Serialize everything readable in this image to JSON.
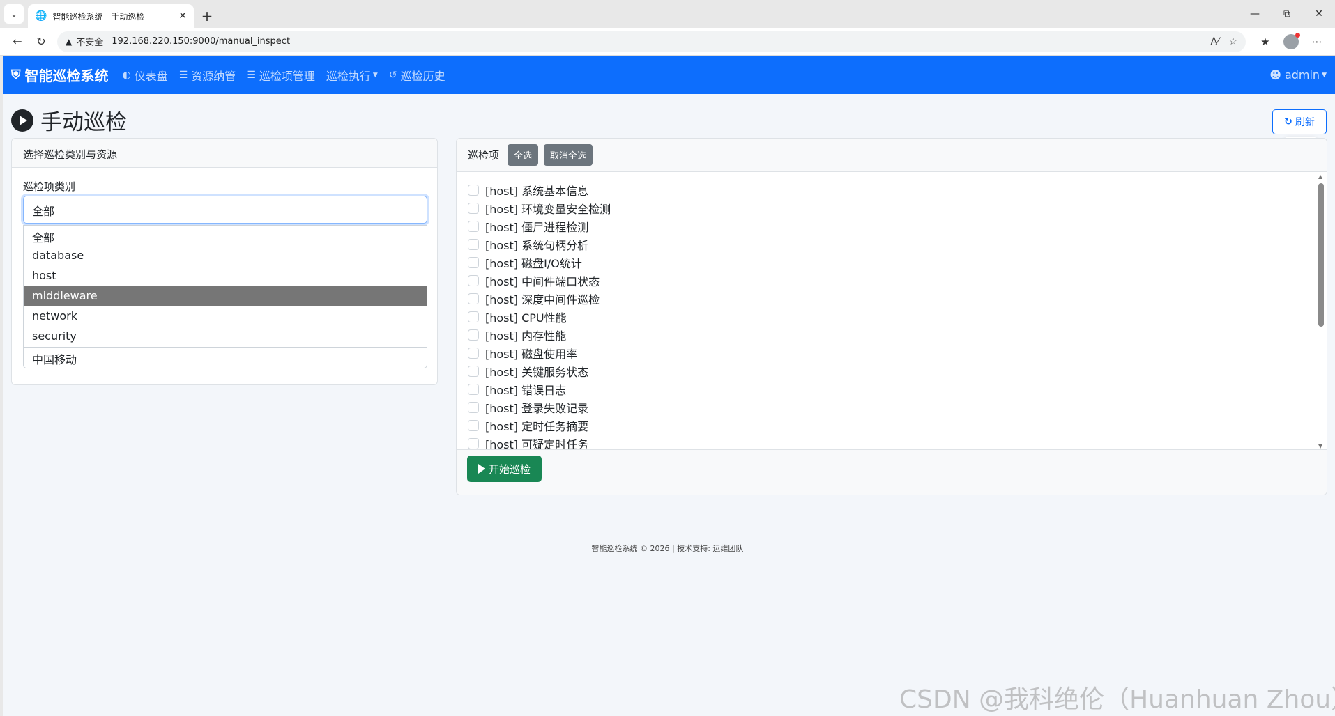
{
  "browser": {
    "tab_title": "智能巡检系统 - 手动巡检",
    "new_tab": "+",
    "insecure_label": "不安全",
    "url": "192.168.220.150:9000/manual_inspect",
    "window_controls": [
      "minimize",
      "restore",
      "close"
    ]
  },
  "navbar": {
    "brand": "智能巡检系统",
    "links": [
      {
        "icon": "dashboard-icon",
        "label": "仪表盘"
      },
      {
        "icon": "database-icon",
        "label": "资源纳管"
      },
      {
        "icon": "list-icon",
        "label": "巡检项管理"
      },
      {
        "icon": "",
        "label": "巡检执行"
      },
      {
        "icon": "history-icon",
        "label": "巡检历史"
      }
    ],
    "user": "admin"
  },
  "page": {
    "title": "手动巡检",
    "refresh_label": "刷新"
  },
  "left_panel": {
    "header": "选择巡检类别与资源",
    "category_label": "巡检项类别",
    "category_value": "全部",
    "options": [
      "全部",
      "database",
      "host",
      "middleware",
      "network",
      "security"
    ],
    "highlighted_option": "middleware",
    "extra_option": "中国移动"
  },
  "right_panel": {
    "header_label": "巡检项",
    "select_all": "全选",
    "deselect_all": "取消全选",
    "items": [
      "[host] 系统基本信息",
      "[host] 环境变量安全检测",
      "[host] 僵尸进程检测",
      "[host] 系统句柄分析",
      "[host] 磁盘I/O统计",
      "[host] 中间件端口状态",
      "[host] 深度中间件巡检",
      "[host] CPU性能",
      "[host] 内存性能",
      "[host] 磁盘使用率",
      "[host] 关键服务状态",
      "[host] 错误日志",
      "[host] 登录失败记录",
      "[host] 定时任务摘要",
      "[host] 可疑定时任务"
    ],
    "start_label": "开始巡检"
  },
  "footer": {
    "text": "智能巡检系统 © 2026 | 技术支持: 运维团队"
  },
  "watermark": "CSDN @我科绝伦（Huanhuan Zhou）",
  "colors": {
    "primary": "#0d6efd",
    "success": "#198754",
    "secondary": "#6c757d"
  }
}
